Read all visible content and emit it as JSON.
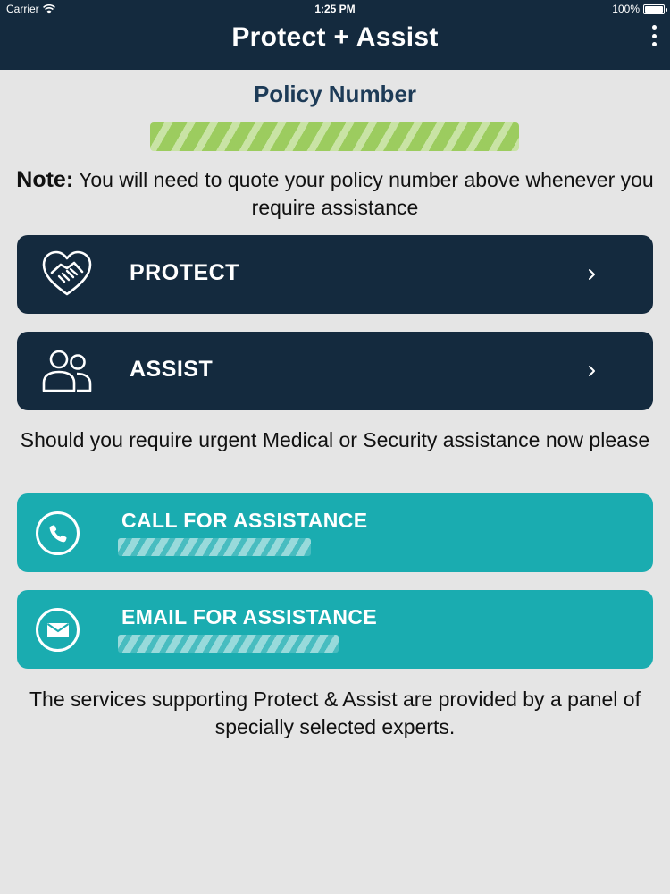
{
  "status_bar": {
    "carrier": "Carrier",
    "time": "1:25 PM",
    "battery": "100%"
  },
  "header": {
    "title": "Protect + Assist",
    "menu_icon": "more-vertical-icon"
  },
  "policy": {
    "label": "Policy Number"
  },
  "note": {
    "bold": "Note:",
    "text": " You will need to quote your policy number above whenever you require assistance"
  },
  "nav_buttons": [
    {
      "label": "PROTECT",
      "icon": "handshake-heart-icon"
    },
    {
      "label": "ASSIST",
      "icon": "users-icon"
    }
  ],
  "urgent_text": "Should you require urgent Medical or Security assistance now please",
  "help_buttons": [
    {
      "label": "CALL FOR ASSISTANCE",
      "icon": "phone-icon"
    },
    {
      "label": "EMAIL FOR ASSISTANCE",
      "icon": "envelope-icon"
    }
  ],
  "footer_text": "The services supporting Protect & Assist are provided by a panel of specially selected experts.",
  "colors": {
    "header_bg": "#142a3e",
    "nav_button_bg": "#142a3e",
    "help_button_bg": "#1aacb0",
    "page_bg": "#e5e5e5",
    "policy_label": "#1d3b57"
  }
}
